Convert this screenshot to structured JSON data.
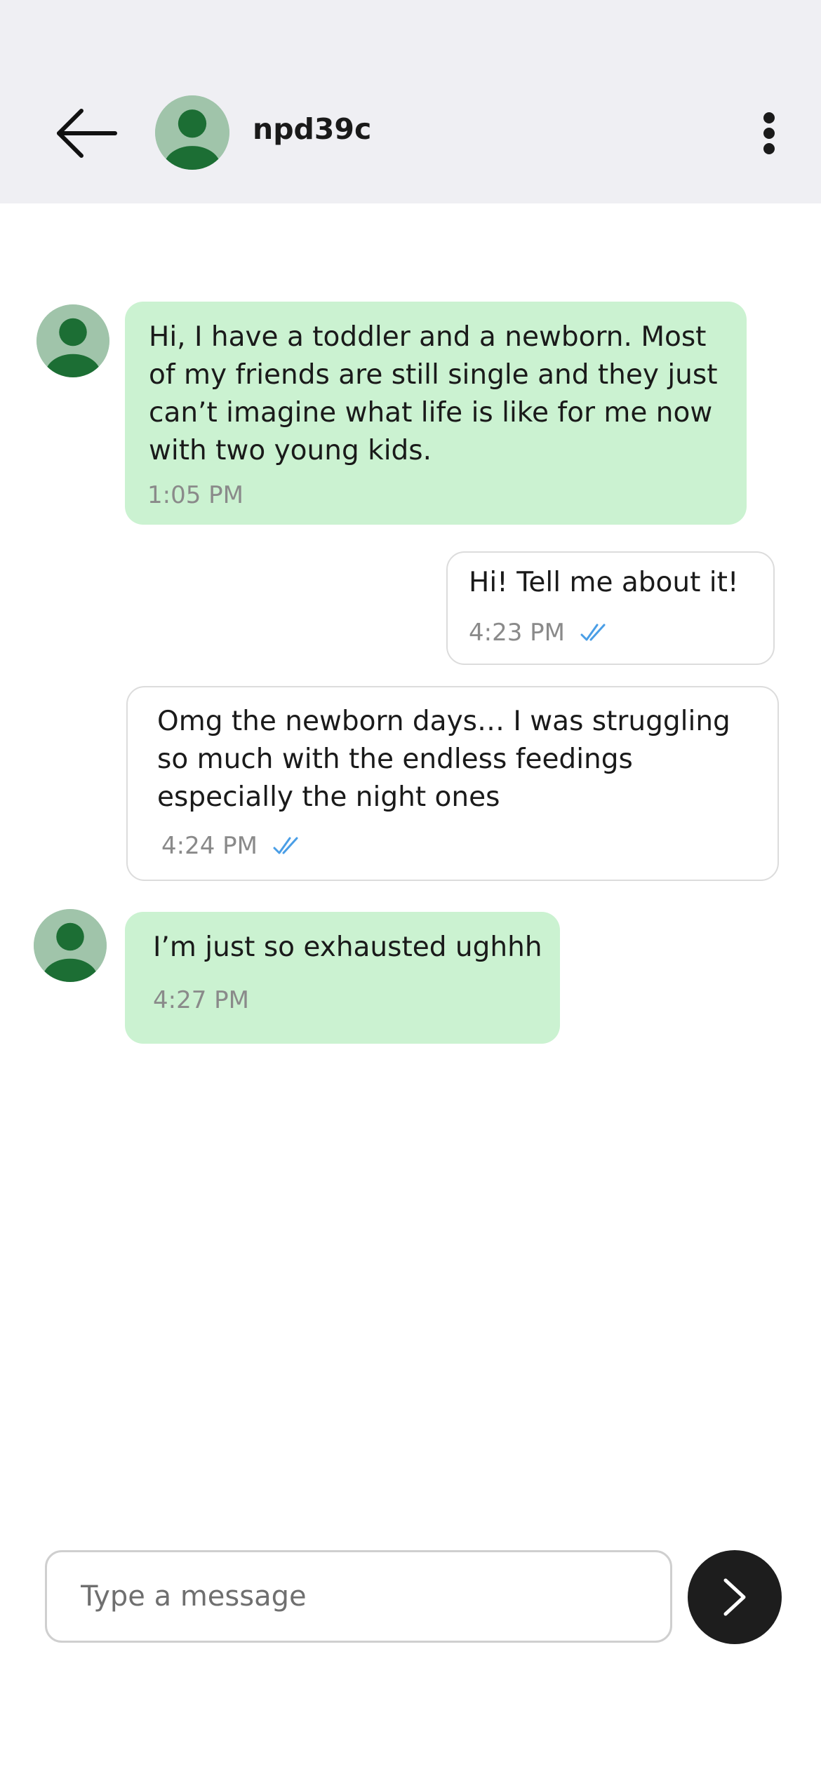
{
  "header": {
    "contact_name": "npd39c",
    "back_icon": "arrow-left-icon",
    "menu_icon": "more-vertical-icon"
  },
  "messages": [
    {
      "direction": "incoming",
      "text": "Hi, I have a toddler and a newborn. Most of my friends are still single and they just can’t imagine what life is like for me now with two young kids.",
      "time": "1:05 PM"
    },
    {
      "direction": "outgoing",
      "text": "Hi! Tell me about it!",
      "time": "4:23 PM",
      "status": "read"
    },
    {
      "direction": "outgoing",
      "text": "Omg the newborn days… I was struggling so much with the endless feedings especially the night ones",
      "time": "4:24 PM",
      "status": "read"
    },
    {
      "direction": "incoming",
      "text": "I’m just so exhausted ughhh",
      "time": "4:27 PM"
    }
  ],
  "composer": {
    "placeholder": "Type a message",
    "value": "",
    "send_icon": "chevron-right-icon"
  },
  "colors": {
    "header_bg": "#efeff3",
    "incoming_bubble": "#cbf2d1",
    "outgoing_border": "#dcdcdc",
    "read_tick": "#4a9ee6",
    "avatar_bg": "#a0c4aa",
    "avatar_figure": "#1c6e34",
    "send_button": "#1d1d1d"
  }
}
